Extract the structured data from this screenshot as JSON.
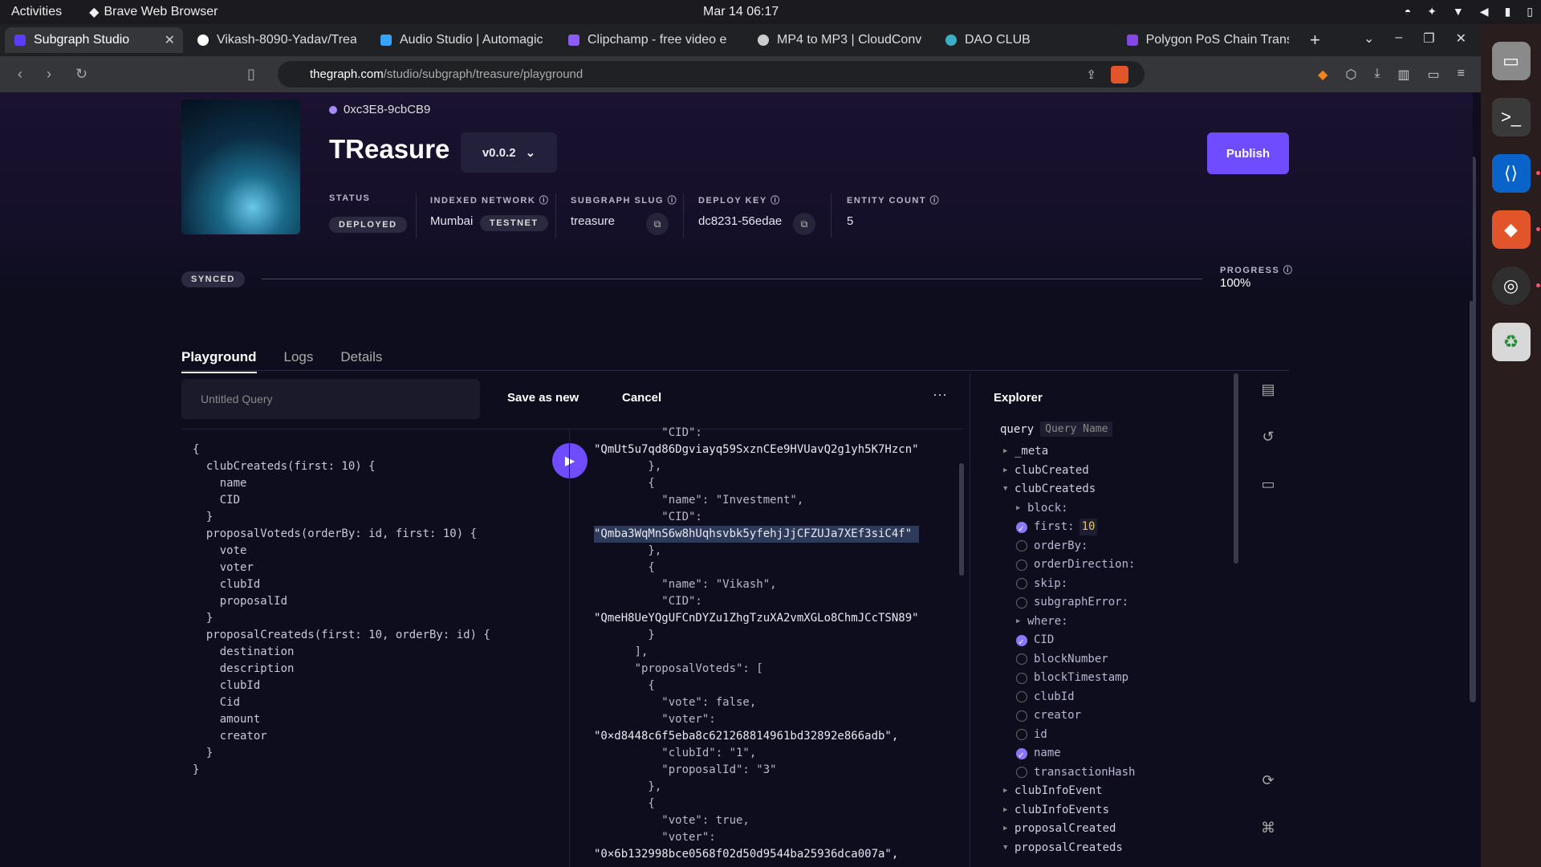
{
  "os": {
    "activities": "Activities",
    "app_name": "Brave Web Browser",
    "clock": "Mar 14  06:17"
  },
  "browser": {
    "tabs": [
      {
        "label": "Subgraph Studio",
        "color": "#5b3cff"
      },
      {
        "label": "Vikash-8090-Yadav/Trea",
        "color": "#ffffff"
      },
      {
        "label": "Audio Studio | Automagic",
        "color": "#38a3ff"
      },
      {
        "label": "Clipchamp - free video e",
        "color": "#8b5cf6"
      },
      {
        "label": "MP4 to MP3 | CloudConv",
        "color": "#cccccc"
      },
      {
        "label": "DAO CLUB",
        "color": "#3ab0c8"
      },
      {
        "label": "Polygon PoS Chain Trans",
        "color": "#8247e5"
      }
    ],
    "url_domain": "thegraph.com",
    "url_path": "/studio/subgraph/treasure/playground"
  },
  "subgraph": {
    "address": "0xc3E8-9cbCB9",
    "name": "TReasure",
    "version": "v0.0.2",
    "publish_label": "Publish",
    "status_label": "STATUS",
    "status_value": "DEPLOYED",
    "network_label": "INDEXED NETWORK",
    "network_value": "Mumbai",
    "network_badge": "TESTNET",
    "slug_label": "SUBGRAPH SLUG",
    "slug_value": "treasure",
    "deploykey_label": "DEPLOY KEY",
    "deploykey_value": "dc8231-56edae",
    "entity_label": "ENTITY COUNT",
    "entity_value": "5",
    "synced_label": "SYNCED",
    "progress_label": "PROGRESS",
    "progress_value": "100%",
    "progress_fraction": 1.0
  },
  "playground": {
    "tabs": [
      "Playground",
      "Logs",
      "Details"
    ],
    "query_placeholder": "Untitled Query",
    "save_as_new": "Save as new",
    "cancel": "Cancel",
    "more": "···",
    "editor_lines": [
      "{",
      "  clubCreateds(first: 10) {",
      "    name",
      "    CID",
      "  }",
      "  proposalVoteds(orderBy: id, first: 10) {",
      "    vote",
      "    voter",
      "    clubId",
      "    proposalId",
      "  }",
      "  proposalCreateds(first: 10, orderBy: id) {",
      "    destination",
      "    description",
      "    clubId",
      "    Cid",
      "    amount",
      "    creator",
      "  }",
      "}"
    ],
    "result_lines": [
      "          \"CID\":",
      "\"QmUt5u7qd86Dgviayq59SxznCEe9HVUavQ2g1yh5K7Hzcn\"",
      "        },",
      "        {",
      "          \"name\": \"Investment\",",
      "          \"CID\":",
      "\"Qmba3WqMnS6w8hUqhsvbk5yfehjJjCFZUJa7XEf3siC4f\"",
      "        },",
      "        {",
      "          \"name\": \"Vikash\",",
      "          \"CID\":",
      "\"QmeH8UeYQgUFCnDYZu1ZhgTzuXA2vmXGLo8ChmJCcTSN89\"",
      "        }",
      "      ],",
      "      \"proposalVoteds\": [",
      "        {",
      "          \"vote\": false,",
      "          \"voter\":",
      "\"0×d8448c6f5eba8c621268814961bd32892e866adb\",",
      "          \"clubId\": \"1\",",
      "          \"proposalId\": \"3\"",
      "        },",
      "        {",
      "          \"vote\": true,",
      "          \"voter\":",
      "\"0×6b132998bce0568f02d50d9544ba25936dca007a\","
    ]
  },
  "explorer": {
    "title": "Explorer",
    "query_kw": "query",
    "query_name": "Query Name",
    "items": [
      {
        "label": "_meta",
        "indent": 0,
        "kind": "caret"
      },
      {
        "label": "clubCreated",
        "indent": 0,
        "kind": "caret"
      },
      {
        "label": "clubCreateds",
        "indent": 0,
        "kind": "open"
      },
      {
        "label": "block:",
        "indent": 1,
        "kind": "caret"
      },
      {
        "label": "first:",
        "indent": 1,
        "kind": "checked",
        "value": "10"
      },
      {
        "label": "orderBy:",
        "indent": 1,
        "kind": "check"
      },
      {
        "label": "orderDirection:",
        "indent": 1,
        "kind": "check"
      },
      {
        "label": "skip:",
        "indent": 1,
        "kind": "check"
      },
      {
        "label": "subgraphError:",
        "indent": 1,
        "kind": "check"
      },
      {
        "label": "where:",
        "indent": 1,
        "kind": "caret"
      },
      {
        "label": "CID",
        "indent": 1,
        "kind": "checked"
      },
      {
        "label": "blockNumber",
        "indent": 1,
        "kind": "check"
      },
      {
        "label": "blockTimestamp",
        "indent": 1,
        "kind": "check"
      },
      {
        "label": "clubId",
        "indent": 1,
        "kind": "check"
      },
      {
        "label": "creator",
        "indent": 1,
        "kind": "check"
      },
      {
        "label": "id",
        "indent": 1,
        "kind": "check"
      },
      {
        "label": "name",
        "indent": 1,
        "kind": "checked"
      },
      {
        "label": "transactionHash",
        "indent": 1,
        "kind": "check"
      },
      {
        "label": "clubInfoEvent",
        "indent": 0,
        "kind": "caret"
      },
      {
        "label": "clubInfoEvents",
        "indent": 0,
        "kind": "caret"
      },
      {
        "label": "proposalCreated",
        "indent": 0,
        "kind": "caret"
      },
      {
        "label": "proposalCreateds",
        "indent": 0,
        "kind": "open"
      }
    ]
  }
}
